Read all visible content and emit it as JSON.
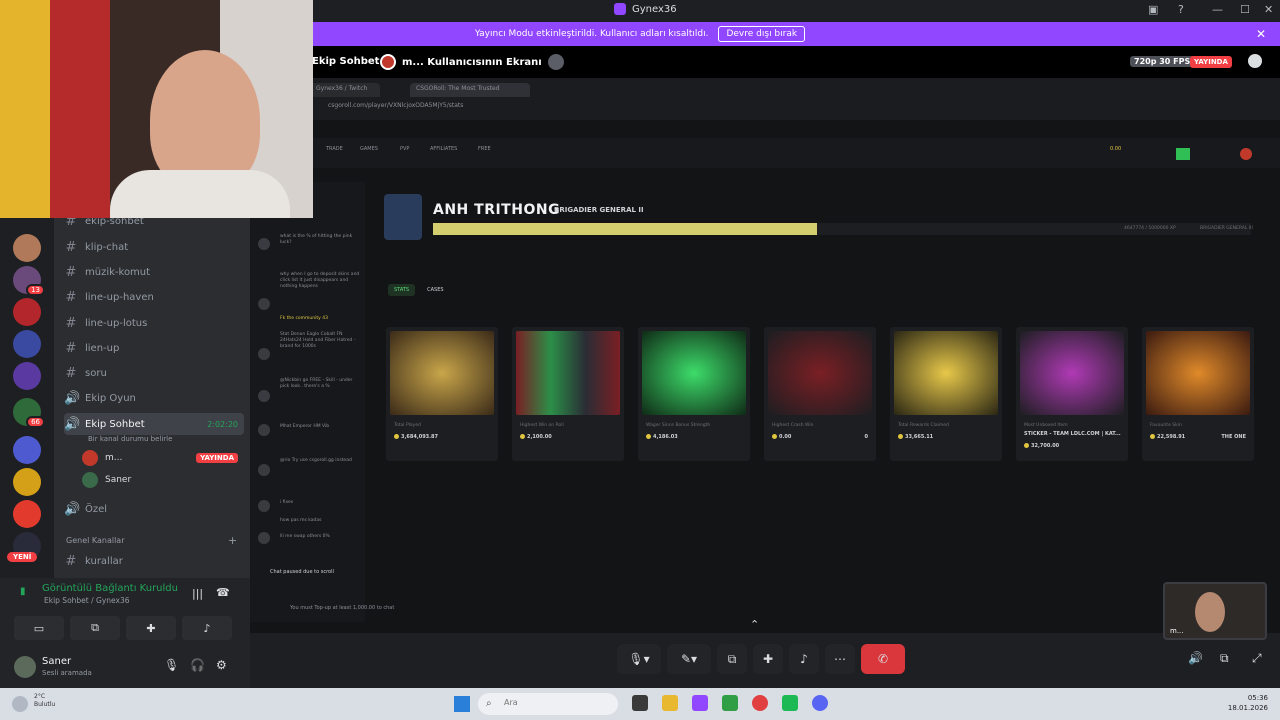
{
  "window": {
    "title": "Gynex36"
  },
  "notice": {
    "text": "Yayıncı Modu etkinleştirildi. Kullanıcı adları kısaltıldı.",
    "button": "Devre dışı bırak"
  },
  "call_header": {
    "channel": "Ekip Sohbet",
    "screen": "m... Kullanıcısının Ekranı",
    "quality": "720p 30 FPS",
    "live": "YAYINDA"
  },
  "servers": {
    "badges": [
      "13",
      "66"
    ],
    "new_label": "YENİ"
  },
  "channels": {
    "items": [
      {
        "name": "ekip-sohbet"
      },
      {
        "name": "klip-chat"
      },
      {
        "name": "müzik-komut"
      },
      {
        "name": "line-up-haven"
      },
      {
        "name": "line-up-lotus"
      },
      {
        "name": "lien-up"
      },
      {
        "name": "soru"
      },
      {
        "name": "Ekip Oyun"
      }
    ],
    "active": {
      "name": "Ekip Sohbet",
      "time": "2:02:20",
      "status": "Bir kanal durumu belirle"
    },
    "members": [
      {
        "name": "m...",
        "badge": "YAYINDA"
      },
      {
        "name": "Saner"
      }
    ],
    "private": "Özel",
    "category": "Genel Kanallar",
    "last": "kurallar"
  },
  "voice": {
    "title": "Görüntülü Bağlantı Kuruldu",
    "sub": "Ekip Sohbet / Gynex36"
  },
  "user": {
    "name": "Saner",
    "status": "Sesli aramada"
  },
  "browser": {
    "tabs": [
      "Gynex36 / Twitch",
      "CSGORoll: The Most Trusted"
    ],
    "url": "csgoroll.com/player/VXNlcjoxODA5MjY5/stats",
    "nav": [
      "TRADE",
      "GAMES",
      "PVP",
      "AFFILIATES",
      "FREE"
    ],
    "balance": "0.00"
  },
  "chat": {
    "lines": [
      "what is the % of hitting the pink luck?",
      "why when I go to deposit skins and click list it just disappears and nothing happens",
      "Fk the community 43",
      "Stat Denon Eagle Cobalt FN 24Hats24 Hold and Fiber Hatred - brand for 1000s",
      "@Nickbin go FREE - Skill - under pick look.. there's a %",
      "Mhat Emperor HM Vib",
      "@rio Try use csgoroll.gg instead",
      "i fixes",
      "how pas ms kadas",
      "lli me swap others 0%"
    ],
    "paused": "Chat paused due to scroll",
    "footer": "You must Top-up at least 1,000.00 to chat"
  },
  "profile": {
    "name": "ANH TRITHONG",
    "rank": "BRIGADIER GENERAL II",
    "progress": 0.47,
    "xp_text": "4647774 / 5000000 XP",
    "rank_right": "BRIGADIER GENERAL III"
  },
  "stat_tabs": [
    "STATS",
    "CASES"
  ],
  "cards": [
    {
      "label": "Total Played",
      "value": "3,684,093.87",
      "value2": ""
    },
    {
      "label": "Highest Win on Roll",
      "value": "2,100.00",
      "value2": ""
    },
    {
      "label": "Wager Since Bonus Strength",
      "value": "4,186.03",
      "value2": ""
    },
    {
      "label": "Highest Crash Win",
      "value": "0.00",
      "value2": "0"
    },
    {
      "label": "Total Rewards Claimed",
      "value": "33,665.11",
      "value2": ""
    },
    {
      "label": "Most Unboxed Item",
      "value": "STICKER - TEAM LDLC.COM | KAT...",
      "value2": ""
    },
    {
      "label": "Favourite Skin",
      "value": "22,598.91",
      "value2": "THE ONE"
    }
  ],
  "card_extra": "32,700.00",
  "mini_cam": {
    "name": "m..."
  },
  "taskbar": {
    "weather_temp": "2°C",
    "weather_text": "Bulutlu",
    "search": "Ara",
    "time": "05:36",
    "date": "18.01.2026"
  }
}
